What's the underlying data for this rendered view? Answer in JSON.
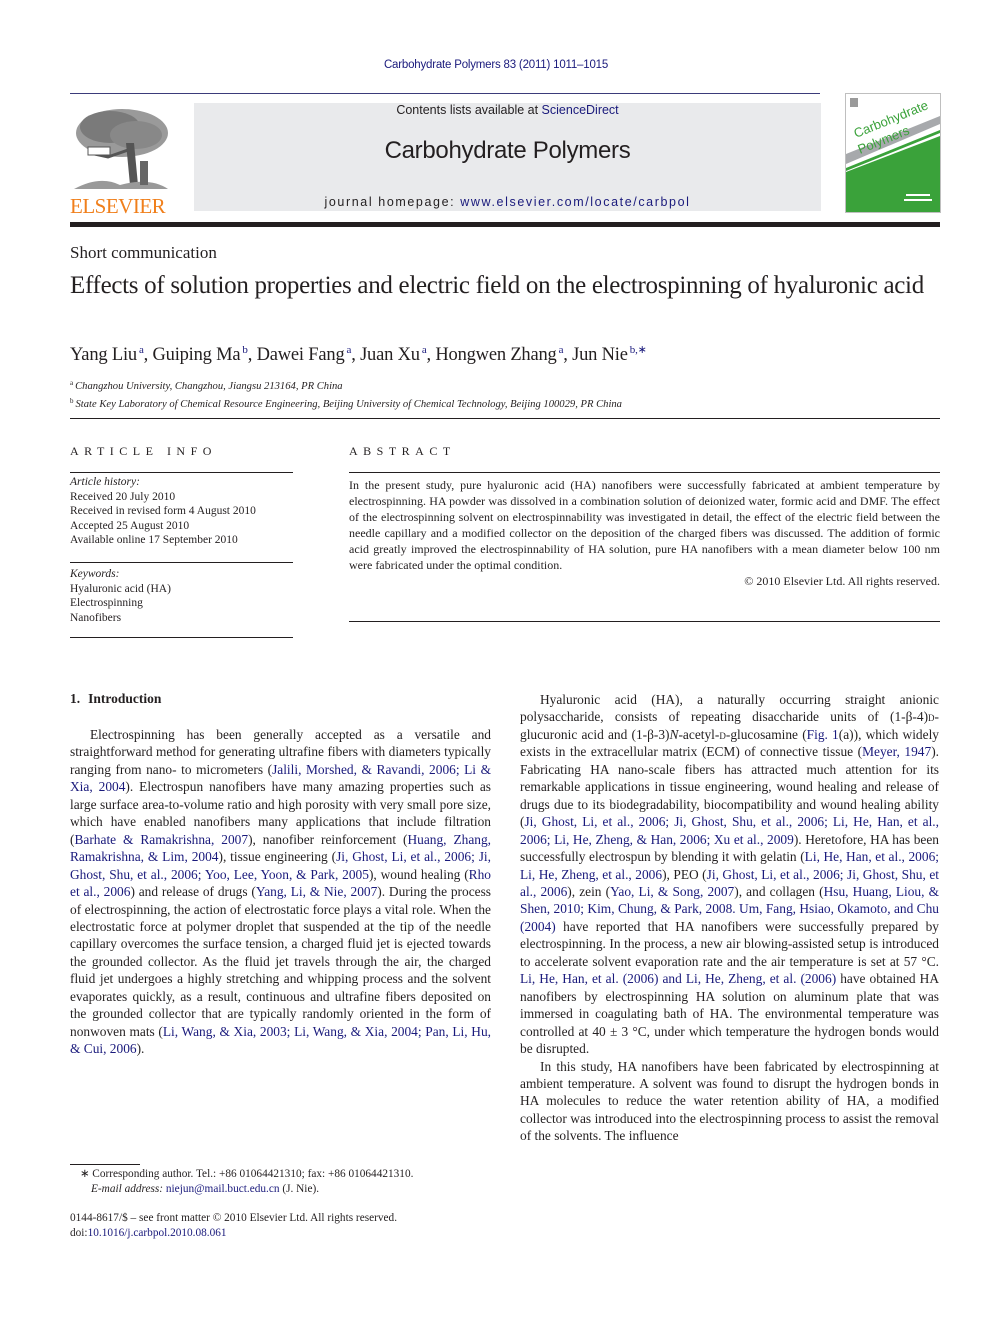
{
  "header": {
    "running_head": "Carbohydrate Polymers 83 (2011) 1011–1015",
    "contents_prefix": "Contents lists available at ",
    "contents_link": "ScienceDirect",
    "journal_title": "Carbohydrate Polymers",
    "homepage_prefix": "journal homepage: ",
    "homepage_link": "www.elsevier.com/locate/carbpol",
    "publisher_wordmark": "ELSEVIER",
    "cover_title_line1": "Carbohydrate",
    "cover_title_line2": "Polymers",
    "brand_colors": {
      "elsevier_orange": "#f07f1b",
      "link_blue": "#1a1a7c",
      "cover_green": "#3aa23a",
      "masthead_gray": "#e9eaec"
    }
  },
  "article": {
    "type": "Short communication",
    "title": "Effects of solution properties and electric field on the electrospinning of hyaluronic acid",
    "authors": [
      {
        "name": "Yang Liu",
        "sup": "a",
        "sep": ", "
      },
      {
        "name": "Guiping Ma",
        "sup": "b",
        "sep": ", "
      },
      {
        "name": "Dawei Fang",
        "sup": "a",
        "sep": ", "
      },
      {
        "name": "Juan Xu",
        "sup": "a",
        "sep": ", "
      },
      {
        "name": "Hongwen Zhang",
        "sup": "a",
        "sep": ", "
      },
      {
        "name": "Jun Nie",
        "sup": "b,∗",
        "sep": ""
      }
    ],
    "affiliations": [
      {
        "key": "a",
        "text": "Changzhou University, Changzhou, Jiangsu 213164, PR China"
      },
      {
        "key": "b",
        "text": "State Key Laboratory of Chemical Resource Engineering, Beijing University of Chemical Technology, Beijing 100029, PR China"
      }
    ]
  },
  "article_info": {
    "heading": "ARTICLE INFO",
    "history_label": "Article history:",
    "history": [
      "Received 20 July 2010",
      "Received in revised form 4 August 2010",
      "Accepted 25 August 2010",
      "Available online 17 September 2010"
    ],
    "keywords_label": "Keywords:",
    "keywords": [
      "Hyaluronic acid (HA)",
      "Electrospinning",
      "Nanofibers"
    ]
  },
  "abstract": {
    "heading": "ABSTRACT",
    "text": "In the present study, pure hyaluronic acid (HA) nanofibers were successfully fabricated at ambient temperature by electrospinning. HA powder was dissolved in a combination solution of deionized water, formic acid and DMF. The effect of the electrospinning solvent on electrospinnability was investigated in detail, the effect of the electric field between the needle capillary and a modified collector on the deposition of the charged fibers was discussed. The addition of formic acid greatly improved the electrospinnability of HA solution, pure HA nanofibers with a mean diameter below 100 nm were fabricated under the optimal condition.",
    "copyright": "© 2010 Elsevier Ltd. All rights reserved."
  },
  "introduction": {
    "number": "1.",
    "heading": "Introduction",
    "left_paragraph": [
      {
        "t": "Electrospinning has been generally accepted as a versatile and straightforward method for generating ultrafine fibers with diameters typically ranging from nano- to micrometers ("
      },
      {
        "l": "Jalili, Morshed, & Ravandi, 2006; Li & Xia, 2004"
      },
      {
        "t": "). Electrospun nanofibers have many amazing properties such as large surface area-to-volume ratio and high porosity with very small pore size, which have enabled nanofibers many applications that include filtration ("
      },
      {
        "l": "Barhate & Ramakrishna, 2007"
      },
      {
        "t": "), nanofiber reinforcement ("
      },
      {
        "l": "Huang, Zhang, Ramakrishna, & Lim, 2004"
      },
      {
        "t": "), tissue engineering ("
      },
      {
        "l": "Ji, Ghost, Li, et al., 2006; Ji, Ghost, Shu, et al., 2006; Yoo, Lee, Yoon, & Park, 2005"
      },
      {
        "t": "), wound healing ("
      },
      {
        "l": "Rho et al., 2006"
      },
      {
        "t": ") and release of drugs ("
      },
      {
        "l": "Yang, Li, & Nie, 2007"
      },
      {
        "t": "). During the process of electrospinning, the action of electrostatic force plays a vital role. When the electrostatic force at polymer droplet that suspended at the tip of the needle capillary overcomes the surface tension, a charged fluid jet is ejected towards the grounded collector. As the fluid jet travels through the air, the charged fluid jet undergoes a highly stretching and whipping process and the solvent evaporates quickly, as a result, continuous and ultrafine fibers deposited on the grounded collector that are typically randomly oriented in the form of nonwoven mats ("
      },
      {
        "l": "Li, Wang, & Xia, 2003; Li, Wang, & Xia, 2004; Pan, Li, Hu, & Cui, 2006"
      },
      {
        "t": ")."
      }
    ],
    "right_paragraph_1": [
      {
        "t": "Hyaluronic acid (HA), a naturally occurring straight anionic polysaccharide, consists of repeating disaccharide units of (1-β-4)"
      },
      {
        "s": "d"
      },
      {
        "t": "-glucuronic acid and (1-β-3)"
      },
      {
        "i": "N"
      },
      {
        "t": "-acetyl-"
      },
      {
        "s": "d"
      },
      {
        "t": "-glucosamine ("
      },
      {
        "l": "Fig. 1"
      },
      {
        "t": "(a)), which widely exists in the extracellular matrix (ECM) of connective tissue ("
      },
      {
        "l": "Meyer, 1947"
      },
      {
        "t": "). Fabricating HA nano-scale fibers has attracted much attention for its remarkable applications in tissue engineering, wound healing and release of drugs due to its biodegradability, biocompatibility and wound healing ability ("
      },
      {
        "l": "Ji, Ghost, Li, et al., 2006; Ji, Ghost, Shu, et al., 2006; Li, He, Han, et al., 2006; Li, He, Zheng, & Han, 2006; Xu et al., 2009"
      },
      {
        "t": "). Heretofore, HA has been successfully electrospun by blending it with gelatin ("
      },
      {
        "l": "Li, He, Han, et al., 2006; Li, He, Zheng, et al., 2006"
      },
      {
        "t": "), PEO ("
      },
      {
        "l": "Ji, Ghost, Li, et al., 2006; Ji, Ghost, Shu, et al., 2006"
      },
      {
        "t": "), zein ("
      },
      {
        "l": "Yao, Li, & Song, 2007"
      },
      {
        "t": "), and collagen ("
      },
      {
        "l": "Hsu, Huang, Liou, & Shen, 2010; Kim, Chung, & Park, 2008. Um, Fang, Hsiao, Okamoto, and Chu (2004)"
      },
      {
        "t": " have reported that HA nanofibers were successfully prepared by electrospinning. In the process, a new air blowing-assisted setup is introduced to accelerate solvent evaporation rate and the air temperature is set at 57 °C. "
      },
      {
        "l": "Li, He, Han, et al. (2006) and Li, He, Zheng, et al. (2006)"
      },
      {
        "t": " have obtained HA nanofibers by electrospinning HA solution on aluminum plate that was immersed in coagulating bath of HA. The environmental temperature was controlled at 40 ± 3 °C, under which temperature the hydrogen bonds would be disrupted."
      }
    ],
    "right_paragraph_2": "In this study, HA nanofibers have been fabricated by electrospinning at ambient temperature. A solvent was found to disrupt the hydrogen bonds in HA molecules to reduce the water retention ability of HA, a modified collector was introduced into the electrospinning process to assist the removal of the solvents. The influence"
  },
  "footnotes": {
    "corresponding": "∗ Corresponding author. Tel.: +86 01064421310; fax: +86 01064421310.",
    "email_label": "E-mail address: ",
    "email": "niejun@mail.buct.edu.cn",
    "email_suffix": " (J. Nie).",
    "front_matter": "0144-8617/$ – see front matter © 2010 Elsevier Ltd. All rights reserved.",
    "doi_label": "doi:",
    "doi": "10.1016/j.carbpol.2010.08.061"
  }
}
